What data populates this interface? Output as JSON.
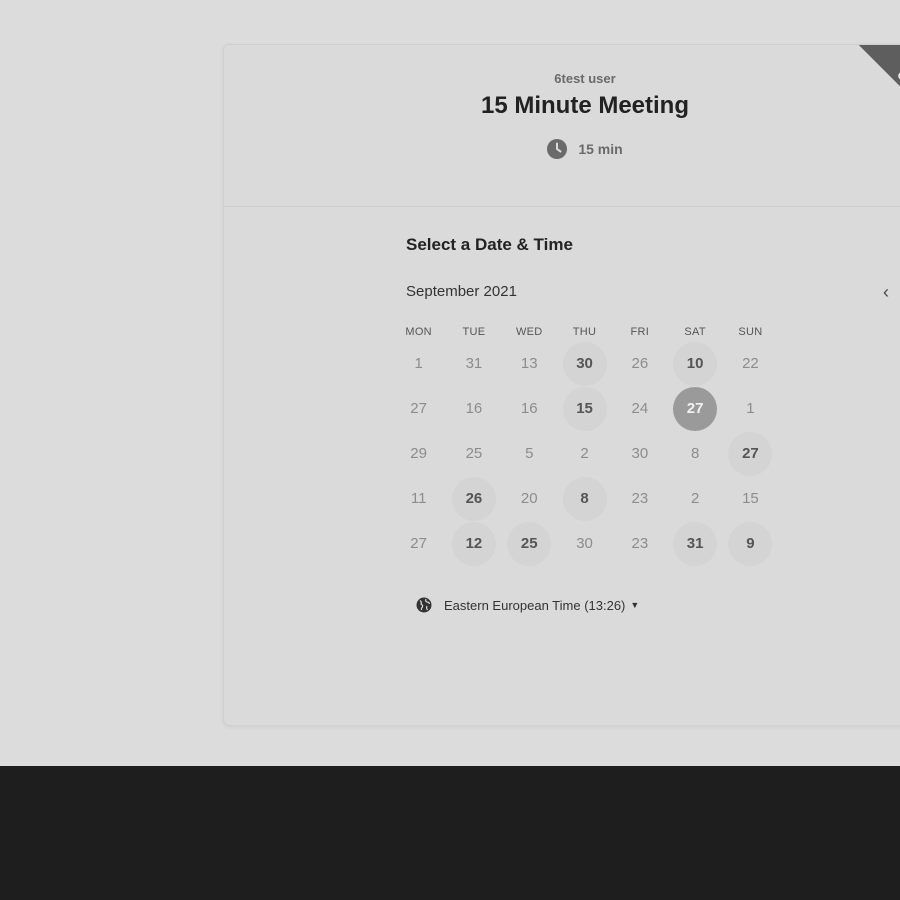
{
  "ribbon": {
    "line1": "P",
    "line2": "Cal"
  },
  "header": {
    "owner": "6test user",
    "title": "15 Minute Meeting",
    "duration": "15 min",
    "duration_icon": "clock-icon"
  },
  "calendar": {
    "section_title": "Select a Date & Time",
    "month": "September 2021",
    "prev_icon": "chevron-left-icon",
    "next_icon": "chevron-right-icon",
    "prev_glyph": "‹",
    "next_glyph": "›",
    "weekdays": [
      "MON",
      "TUE",
      "WED",
      "THU",
      "FRI",
      "SAT",
      "SUN"
    ],
    "weeks": [
      [
        {
          "label": "1",
          "state": "disabled"
        },
        {
          "label": "31",
          "state": "disabled"
        },
        {
          "label": "13",
          "state": "disabled"
        },
        {
          "label": "30",
          "state": "available"
        },
        {
          "label": "26",
          "state": "disabled"
        },
        {
          "label": "10",
          "state": "available"
        },
        {
          "label": "22",
          "state": "disabled"
        }
      ],
      [
        {
          "label": "27",
          "state": "disabled"
        },
        {
          "label": "16",
          "state": "disabled"
        },
        {
          "label": "16",
          "state": "disabled"
        },
        {
          "label": "15",
          "state": "available"
        },
        {
          "label": "24",
          "state": "disabled"
        },
        {
          "label": "27",
          "state": "selected"
        },
        {
          "label": "1",
          "state": "disabled"
        }
      ],
      [
        {
          "label": "29",
          "state": "disabled"
        },
        {
          "label": "25",
          "state": "disabled"
        },
        {
          "label": "5",
          "state": "disabled"
        },
        {
          "label": "2",
          "state": "disabled"
        },
        {
          "label": "30",
          "state": "disabled"
        },
        {
          "label": "8",
          "state": "disabled"
        },
        {
          "label": "27",
          "state": "available"
        }
      ],
      [
        {
          "label": "11",
          "state": "disabled"
        },
        {
          "label": "26",
          "state": "available"
        },
        {
          "label": "20",
          "state": "disabled"
        },
        {
          "label": "8",
          "state": "available"
        },
        {
          "label": "23",
          "state": "disabled"
        },
        {
          "label": "2",
          "state": "disabled"
        },
        {
          "label": "15",
          "state": "disabled"
        }
      ],
      [
        {
          "label": "27",
          "state": "disabled"
        },
        {
          "label": "12",
          "state": "available"
        },
        {
          "label": "25",
          "state": "available"
        },
        {
          "label": "30",
          "state": "disabled"
        },
        {
          "label": "23",
          "state": "disabled"
        },
        {
          "label": "31",
          "state": "available"
        },
        {
          "label": "9",
          "state": "available"
        }
      ]
    ]
  },
  "timezone": {
    "label": "Eastern European Time (13:26)",
    "icon": "globe-icon",
    "caret": "▼"
  },
  "colors": {
    "page_bg": "#dcdcdc",
    "footer_bg": "#1e1e1e",
    "selected_bg": "#9a9a9a",
    "available_bg": "#d4d4d4",
    "ribbon_bg": "#5e5e5e"
  }
}
